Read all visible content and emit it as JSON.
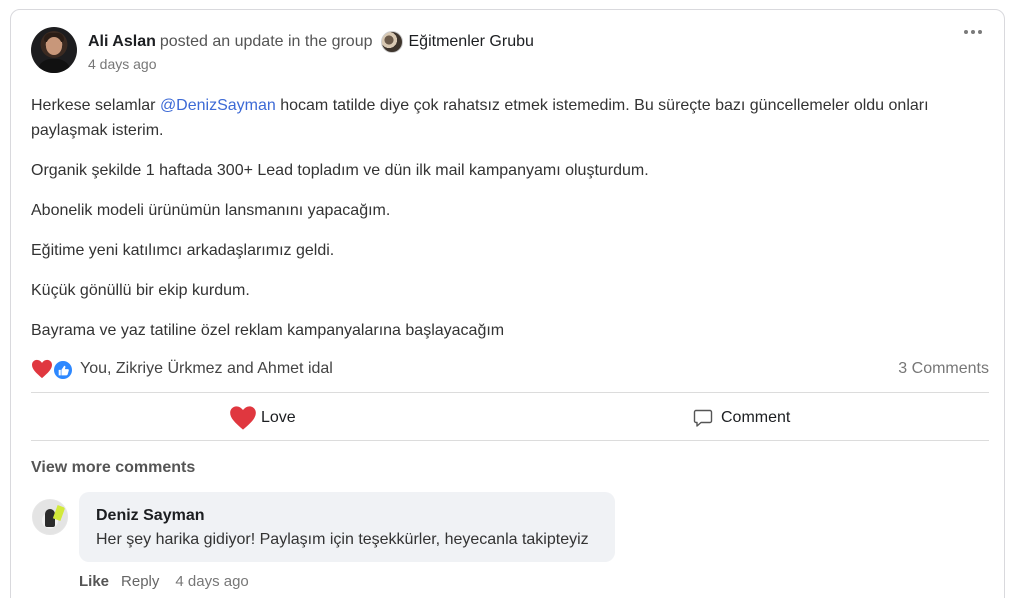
{
  "post": {
    "author": "Ali Aslan",
    "verb": "posted an update in the group",
    "group_name": "Eğitmenler Grubu",
    "timestamp": "4 days ago",
    "body": {
      "p1_before_mention": "Herkese selamlar ",
      "mention": "@DenizSayman",
      "p1_after_mention": " hocam tatilde diye çok rahatsız etmek istemedim. Bu süreçte bazı güncellemeler oldu onları paylaşmak isterim.",
      "p2": "Organik şekilde 1 haftada 300+ Lead topladım ve dün ilk mail kampanyamı oluşturdum.",
      "p3": "Abonelik modeli ürünümün lansmanını yapacağım.",
      "p4": "Eğitime yeni katılımcı arkadaşlarımız geldi.",
      "p5": "Küçük gönüllü bir ekip kurdum.",
      "p6": "Bayrama ve yaz tatiline özel reklam kampanyalarına başlayacağım"
    },
    "reactors": "You, Zikriye Ürkmez and Ahmet idal",
    "comment_count": "3 Comments",
    "reaction_icons": [
      "heart-icon",
      "thumbs-up-icon"
    ]
  },
  "actions": {
    "love_label": "Love",
    "comment_label": "Comment"
  },
  "comments": {
    "view_more": "View more comments",
    "items": [
      {
        "author": "Deniz Sayman",
        "text": "Her şey harika gidiyor! Paylaşım için teşekkürler, heyecanla takipteyiz",
        "like": "Like",
        "reply": "Reply",
        "time": "4 days ago"
      }
    ]
  },
  "colors": {
    "mention": "#3d6ad6",
    "love": "#e0373f",
    "like_badge": "#2d88ff",
    "bubble": "#f0f2f5"
  }
}
